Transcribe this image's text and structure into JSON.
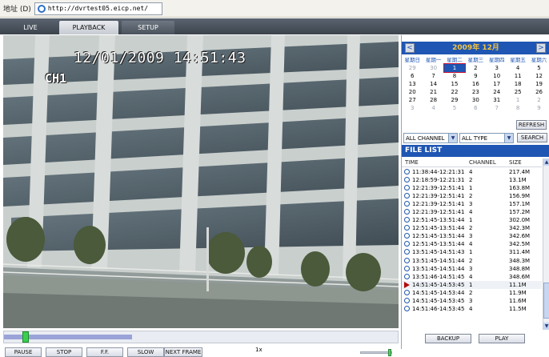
{
  "address_bar": {
    "label": "地址 (D)",
    "url": "http://dvrtest05.eicp.net/"
  },
  "tabs": [
    "LIVE",
    "PLAYBACK",
    "SETUP"
  ],
  "video": {
    "timestamp": "12/01/2009 14:51:43",
    "channel": "CH1"
  },
  "controls": {
    "buttons": [
      "PAUSE",
      "STOP",
      "F.F.",
      "SLOW",
      "NEXT FRAME"
    ],
    "speed": "1x"
  },
  "calendar": {
    "title": "2009年 12月",
    "prev_label": "<",
    "next_label": ">",
    "weekdays": [
      "星期日",
      "星期一",
      "星期二",
      "星期三",
      "星期四",
      "星期五",
      "星期六"
    ],
    "weeks": [
      [
        "29",
        "30",
        "1",
        "2",
        "3",
        "4",
        "5"
      ],
      [
        "6",
        "7",
        "8",
        "9",
        "10",
        "11",
        "12"
      ],
      [
        "13",
        "14",
        "15",
        "16",
        "17",
        "18",
        "19"
      ],
      [
        "20",
        "21",
        "22",
        "23",
        "24",
        "25",
        "26"
      ],
      [
        "27",
        "28",
        "29",
        "30",
        "31",
        "1",
        "2"
      ],
      [
        "3",
        "4",
        "5",
        "6",
        "7",
        "8",
        "9"
      ]
    ],
    "selected": "1"
  },
  "panel": {
    "refresh_label": "REFRESH",
    "channel_select": "ALL CHANNEL",
    "type_select": "ALL TYPE",
    "search_label": "SEARCH",
    "file_list_title": "FILE LIST",
    "columns": {
      "time": "TIME",
      "channel": "CHANNEL",
      "size": "SIZE"
    },
    "files": [
      {
        "time": "11:38:44-12:21:31",
        "channel": "4",
        "size": "217.4M"
      },
      {
        "time": "12:18:59-12:21:31",
        "channel": "2",
        "size": "13.1M"
      },
      {
        "time": "12:21:39-12:51:41",
        "channel": "1",
        "size": "163.8M"
      },
      {
        "time": "12:21:39-12:51:41",
        "channel": "2",
        "size": "156.9M"
      },
      {
        "time": "12:21:39-12:51:41",
        "channel": "3",
        "size": "157.1M"
      },
      {
        "time": "12:21:39-12:51:41",
        "channel": "4",
        "size": "157.2M"
      },
      {
        "time": "12:51:45-13:51:44",
        "channel": "1",
        "size": "302.0M"
      },
      {
        "time": "12:51:45-13:51:44",
        "channel": "2",
        "size": "342.3M"
      },
      {
        "time": "12:51:45-13:51:44",
        "channel": "3",
        "size": "342.6M"
      },
      {
        "time": "12:51:45-13:51:44",
        "channel": "4",
        "size": "342.5M"
      },
      {
        "time": "13:51:45-14:51:43",
        "channel": "1",
        "size": "311.4M"
      },
      {
        "time": "13:51:45-14:51:44",
        "channel": "2",
        "size": "348.3M"
      },
      {
        "time": "13:51:45-14:51:44",
        "channel": "3",
        "size": "348.8M"
      },
      {
        "time": "13:51:46-14:51:45",
        "channel": "4",
        "size": "348.6M"
      },
      {
        "time": "14:51:45-14:53:45",
        "channel": "1",
        "size": "11.1M"
      },
      {
        "time": "14:51:45-14:53:44",
        "channel": "2",
        "size": "11.9M"
      },
      {
        "time": "14:51:45-14:53:45",
        "channel": "3",
        "size": "11.6M"
      },
      {
        "time": "14:51:46-14:53:45",
        "channel": "4",
        "size": "11.5M"
      }
    ],
    "playing_index": 14,
    "backup_label": "BACKUP",
    "play_label": "PLAY"
  },
  "colors": {
    "accent": "#1f56b3",
    "calendar_title": "#f4c542",
    "progress": "#9aa3d8",
    "handle": "#39d04b"
  }
}
